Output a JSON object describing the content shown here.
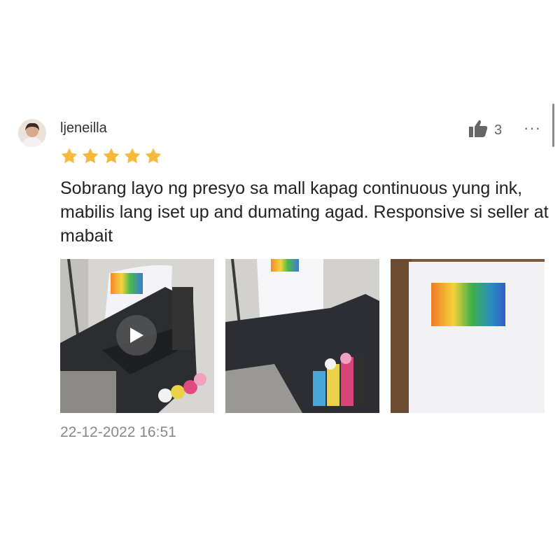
{
  "review": {
    "username": "ljeneilla",
    "rating": 5,
    "likes": "3",
    "more_label": "···",
    "comment": "Sobrang layo ng presyo sa mall kapag continuous yung ink, mabilis lang iset up and dumating agad. Responsive si seller at mabait",
    "timestamp": "22-12-2022 16:51",
    "colors": {
      "star": "#F6B93B",
      "text": "#222222",
      "muted": "#888888"
    },
    "media": [
      {
        "kind": "video",
        "icon": "play-icon"
      },
      {
        "kind": "image"
      },
      {
        "kind": "image"
      }
    ]
  }
}
